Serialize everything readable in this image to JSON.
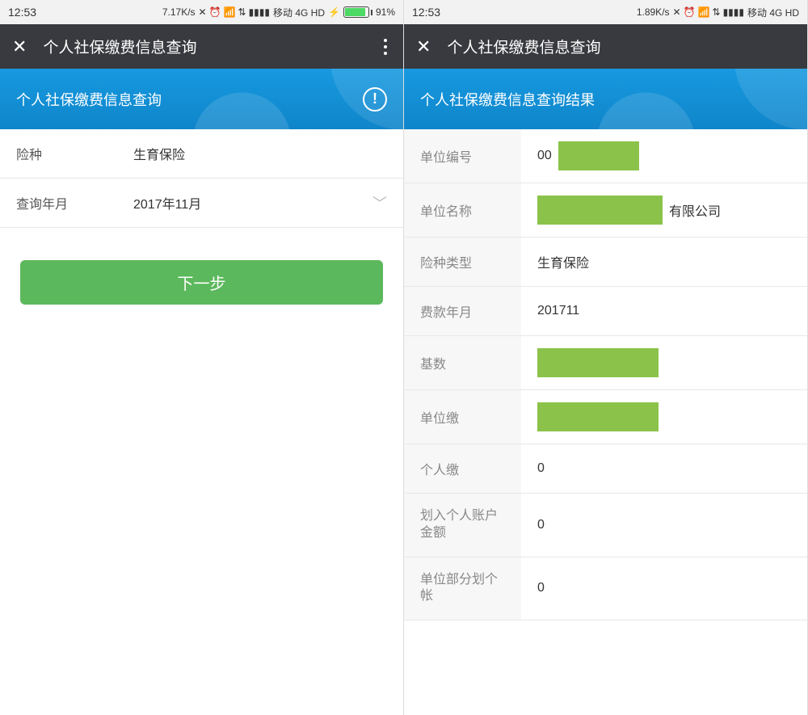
{
  "left": {
    "status": {
      "time": "12:53",
      "speed": "7.17K/s",
      "carrier": "移动 4G HD",
      "charging_icon": "⚡",
      "battery_pct": "91%"
    },
    "nav": {
      "title": "个人社保缴费信息查询"
    },
    "header": {
      "title": "个人社保缴费信息查询"
    },
    "form": {
      "type_label": "险种",
      "type_value": "生育保险",
      "date_label": "查询年月",
      "date_value": "2017年11月"
    },
    "next_label": "下一步"
  },
  "right": {
    "status": {
      "time": "12:53",
      "speed": "1.89K/s",
      "carrier": "移动 4G HD"
    },
    "nav": {
      "title": "个人社保缴费信息查询"
    },
    "header": {
      "title": "个人社保缴费信息查询结果"
    },
    "rows": {
      "unit_no_label": "单位编号",
      "unit_no_prefix": "00",
      "unit_name_label": "单位名称",
      "unit_name_suffix": "有限公司",
      "type_label": "险种类型",
      "type_value": "生育保险",
      "period_label": "费款年月",
      "period_value": "201711",
      "base_label": "基数",
      "unit_pay_label": "单位缴",
      "personal_pay_label": "个人缴",
      "personal_pay_value": "0",
      "personal_acct_label": "划入个人账户金额",
      "personal_acct_value": "0",
      "unit_split_label": "单位部分划个帐",
      "unit_split_value": "0"
    }
  }
}
